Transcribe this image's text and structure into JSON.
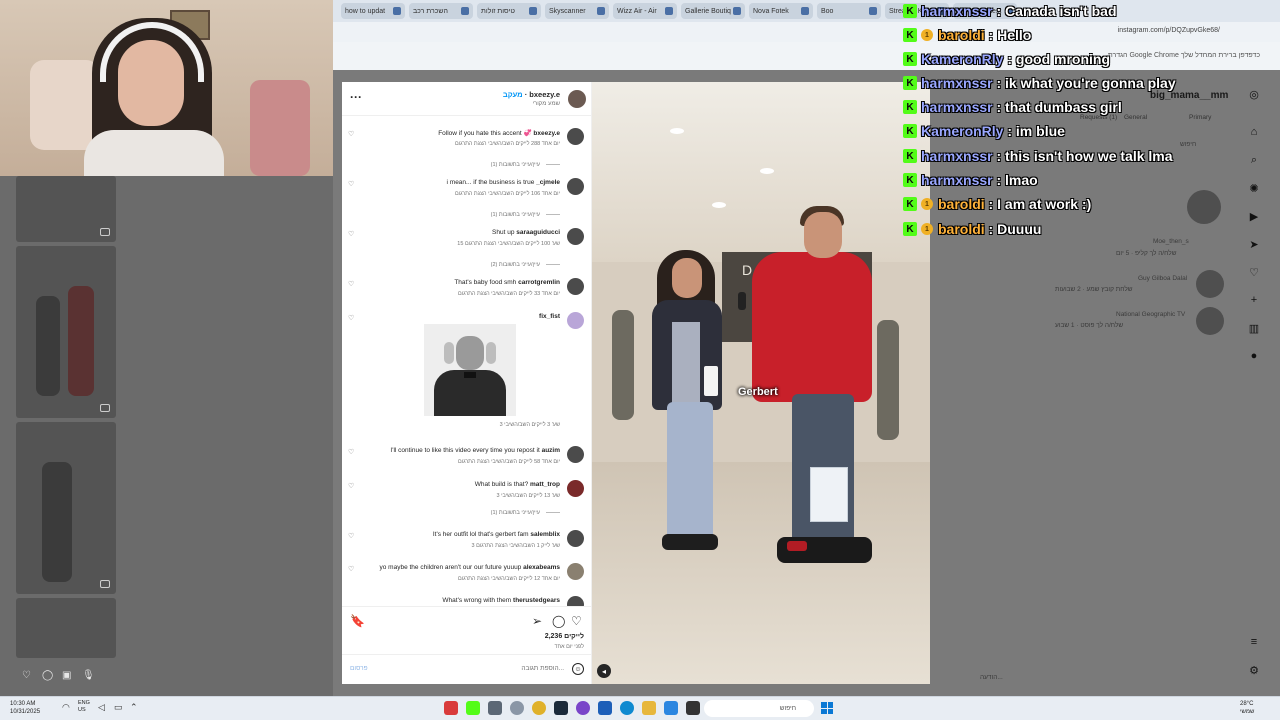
{
  "browser": {
    "tabs": [
      {
        "label": "how to updat"
      },
      {
        "label": "השכרת רכב"
      },
      {
        "label": "טיסות זולות"
      },
      {
        "label": "Skyscanner"
      },
      {
        "label": "Wizz Air - Air"
      },
      {
        "label": "Gallerie Boutiq"
      },
      {
        "label": "Nova Fotek"
      },
      {
        "label": "Boo"
      },
      {
        "label": "Stream - Kick"
      },
      {
        "label": "wifi speed test"
      }
    ],
    "url": "instagram.com/p/DQZupvGke68/",
    "bookmark_note": "הגדרת Google Chrome כדפדפן ברירת המחדל שלך"
  },
  "post": {
    "username": "bxeezy.e",
    "follow": "מעקב",
    "subtitle": "שמע מקורי",
    "more": "···",
    "video_caption": "Gerbert",
    "likes": "2,236 לייקים",
    "time": "לפני יום אחד",
    "add_comment": "הוספת תגובה...",
    "post_button": "פרסום"
  },
  "comments": [
    {
      "user": "bxeezy.e",
      "text": "Follow if you hate this accent 💞",
      "meta": "יום אחד  288 לייקים   השב/השיבי   הצגת התרגום",
      "replies": "עיין/עייני בתשובות (1)"
    },
    {
      "user": "_cjmele",
      "text": "i mean... if the business is true",
      "meta": "יום אחד  106 לייקים   השב/השיבי   הצגת התרגום",
      "replies": "עיין/עייני בתשובות (1)"
    },
    {
      "user": "saraaguiducci",
      "text": "Shut up",
      "meta": "15 שע'  100 לייקים   השב/השיבי   הצגת התרגום",
      "replies": "עיין/עייני בתשובות (2)"
    },
    {
      "user": "carrotgremlin",
      "text": "That's baby food smh",
      "meta": "יום אחד  33 לייקים   השב/השיבי   הצגת התרגום",
      "replies": ""
    },
    {
      "user": "fix_fist",
      "text": "",
      "meta": "3 שע'  3 לייקים   השב/השיבי",
      "replies": ""
    },
    {
      "user": "auzim",
      "text": "I'll continue to like this video every time you repost it",
      "meta": "יום אחד  58 לייקים   השב/השיבי   הצגת התרגום",
      "replies": ""
    },
    {
      "user": "matt_trop",
      "text": "What build is that?",
      "meta": "3 שע'  13 לייקים   השב/השיבי",
      "replies": "עיין/עייני בתשובות (1)"
    },
    {
      "user": "salemblix",
      "text": "It's her outfit lol that's gerbert fam",
      "meta": "3 שע'  לייק 1   השב/השיבי   הצגת התרגום",
      "replies": ""
    },
    {
      "user": "alexabeams",
      "text": "yo maybe the children aren't our our future yuuup",
      "meta": "יום אחד  12 לייקים   השב/השיבי   הצגת התרגום",
      "replies": ""
    },
    {
      "user": "therustedgears",
      "text": "What's wrong with them",
      "meta": "",
      "replies": ""
    }
  ],
  "chat": [
    {
      "user": "harmxnssr",
      "message": "Canada isn't bad",
      "badge": "k",
      "color": "blue"
    },
    {
      "user": "baroldi",
      "message": "Hello",
      "badge": "k-sub",
      "color": "orange"
    },
    {
      "user": "KameronRly",
      "message": "good mroning",
      "badge": "k",
      "color": "blue"
    },
    {
      "user": "harmxnssr",
      "message": "ik what you're gonna play",
      "badge": "k",
      "color": "blue"
    },
    {
      "user": "harmxnssr",
      "message": "that dumbass girl",
      "badge": "k",
      "color": "blue"
    },
    {
      "user": "KameronRly",
      "message": "im blue",
      "badge": "k",
      "color": "blue"
    },
    {
      "user": "harmxnssr",
      "message": "this isn't how we talk lma",
      "badge": "k",
      "color": "blue"
    },
    {
      "user": "harmxnssr",
      "message": "lmao",
      "badge": "k",
      "color": "blue"
    },
    {
      "user": "baroldi",
      "message": "I am at work :)",
      "badge": "k-sub",
      "color": "orange"
    },
    {
      "user": "baroldi",
      "message": "Duuuu",
      "badge": "k-sub",
      "color": "orange"
    }
  ],
  "sidebar": {
    "username": "big_mama__mm",
    "tabs": [
      "Requests (1)",
      "General",
      "Primary"
    ],
    "search_placeholder": "חיפוש",
    "rows": [
      {
        "name": "Moe_then_s",
        "preview": "שלח/ה לך קליפ · 5 יום"
      },
      {
        "name": "Guy Gilboa Dalal",
        "preview": "שלחת קובץ שמע · 2 שבועות"
      },
      {
        "name": "National Geographic TV",
        "preview": "שלח/ה לך פוסט · 1 שבוע"
      }
    ],
    "message_placeholder": "הודעה..."
  },
  "taskbar": {
    "time": "10:30 AM",
    "date": "10/31/2025",
    "lang": "ENG",
    "region": "US",
    "search": "חיפוש",
    "temp": "28°C",
    "weather": "שמשי"
  }
}
